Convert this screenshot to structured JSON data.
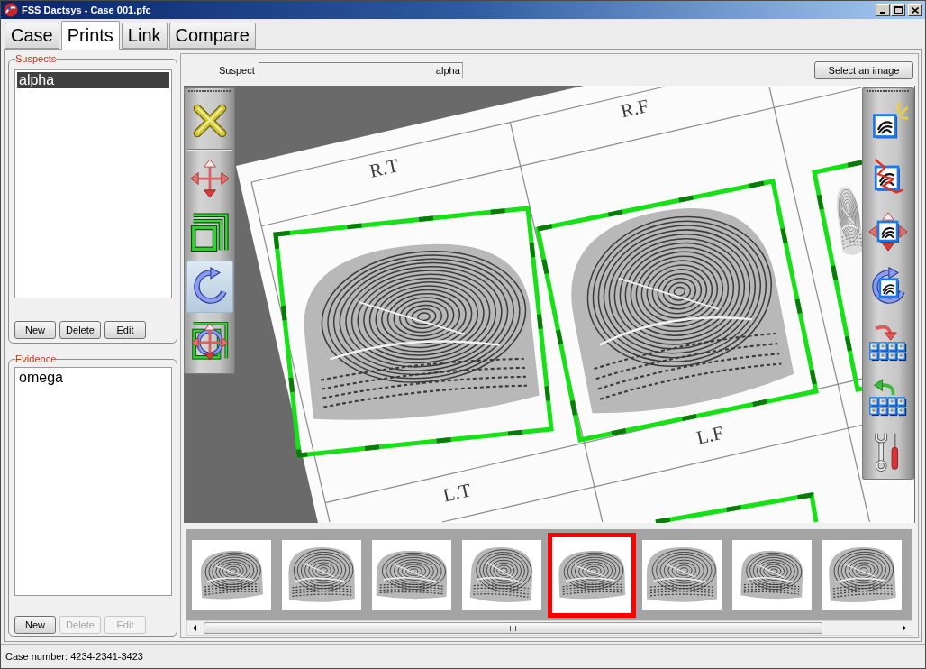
{
  "window": {
    "title": "FSS Dactsys - Case 001.pfc"
  },
  "tabs": [
    {
      "label": "Case",
      "selected": false
    },
    {
      "label": "Prints",
      "selected": true
    },
    {
      "label": "Link",
      "selected": false
    },
    {
      "label": "Compare",
      "selected": false
    }
  ],
  "suspects": {
    "title": "Suspects",
    "items": [
      {
        "label": "alpha",
        "selected": true
      }
    ],
    "buttons": [
      {
        "label": "New",
        "disabled": false
      },
      {
        "label": "Delete",
        "disabled": false
      },
      {
        "label": "Edit",
        "disabled": false
      }
    ]
  },
  "evidence": {
    "title": "Evidence",
    "items": [
      {
        "label": "omega",
        "selected": false
      }
    ],
    "buttons": [
      {
        "label": "New",
        "disabled": false
      },
      {
        "label": "Delete",
        "disabled": true
      },
      {
        "label": "Edit",
        "disabled": true
      }
    ]
  },
  "image_panel": {
    "suspect_field": {
      "label": "Suspect",
      "value": "alpha"
    },
    "select_button": "Select an image",
    "left_tools": [
      {
        "kind": "delete",
        "selected": false
      },
      {
        "kind": "move",
        "selected": false
      },
      {
        "kind": "resize",
        "selected": false
      },
      {
        "kind": "rotate",
        "selected": true
      },
      {
        "kind": "transform",
        "selected": false
      }
    ],
    "right_tools": [
      {
        "kind": "enhance"
      },
      {
        "kind": "distort"
      },
      {
        "kind": "move"
      },
      {
        "kind": "rotate"
      },
      {
        "kind": "apply_all"
      },
      {
        "kind": "undo_all"
      },
      {
        "kind": "settings"
      }
    ],
    "card_labels": [
      "R.T",
      "R.F",
      "L.T",
      "L.F"
    ],
    "thumbnails": [
      {
        "selected": false
      },
      {
        "selected": false
      },
      {
        "selected": false
      },
      {
        "selected": false
      },
      {
        "selected": true
      },
      {
        "selected": false
      },
      {
        "selected": false
      },
      {
        "selected": false
      }
    ]
  },
  "status_bar": {
    "text": "Case number: 4234-2341-3423"
  }
}
